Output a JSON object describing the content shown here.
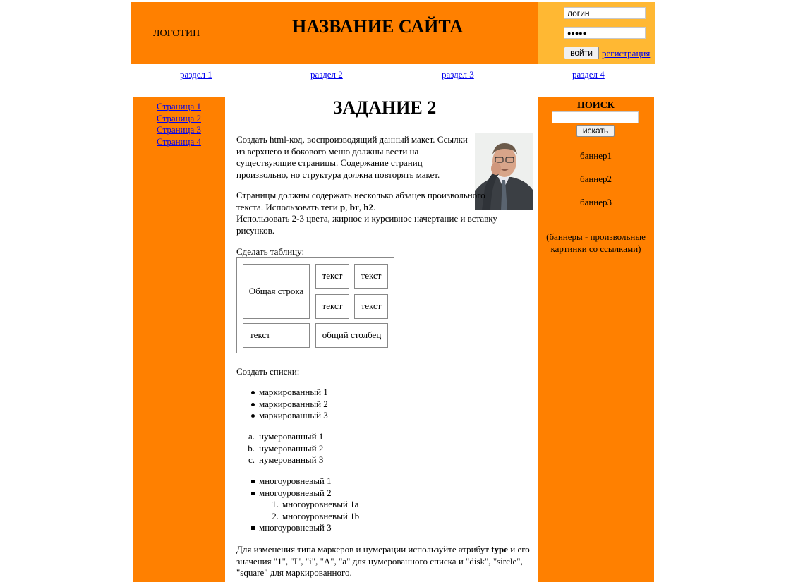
{
  "header": {
    "logo": "ЛОГОТИП",
    "site_title": "НАЗВАНИЕ САЙТА",
    "login_value": "логин",
    "password_value": "●●●●●",
    "login_button": "войти",
    "register_link": "регистрация"
  },
  "topnav": [
    "раздел 1",
    "раздел 2",
    "раздел 3",
    "раздел 4"
  ],
  "sidebar": {
    "pages": [
      "Страница 1",
      "Страница 2",
      "Страница 3",
      "Страница 4"
    ]
  },
  "search": {
    "title": "ПОИСК",
    "button": "искать"
  },
  "banners": [
    "баннер1",
    "баннер2",
    "баннер3"
  ],
  "banner_note": "(баннеры - произвольные картинки со ссылками)",
  "main": {
    "title": "ЗАДАНИЕ 2",
    "p1": "Создать html-код, воспроизводящий данный макет. Ссылки из верхнего и бокового меню должны вести на существующие страницы. Содержание страниц произвольно, но структура должна повторять макет.",
    "p2_a": "Страницы должны содержать несколько абзацев произвольного текста. Использовать теги ",
    "p2_tag1": "p",
    "p2_sep1": ", ",
    "p2_tag2": "br",
    "p2_sep2": ", ",
    "p2_tag3": "h2",
    "p2_b": ".",
    "p2_c": "Использовать 2-3 цвета, жирное и курсивное начертание и вставку рисунков.",
    "p3": "Сделать таблицу:",
    "table": {
      "merged_row": "Общая строка",
      "cell_text": "текст",
      "merged_col": "общий столбец"
    },
    "p4": "Создать списки:",
    "bullet_list": [
      "маркированный 1",
      "маркированный 2",
      "маркированный 3"
    ],
    "alpha_markers": [
      "a.",
      "b.",
      "c."
    ],
    "alpha_list": [
      "нумерованный 1",
      "нумерованный 2",
      "нумерованный 3"
    ],
    "multi_list": [
      "многоуровневый 1",
      "многоуровневый 2",
      "многоуровневый 3"
    ],
    "sub_markers": [
      "1.",
      "2."
    ],
    "sub_list": [
      "многоуровневый 1a",
      "многоуровневый 1b"
    ],
    "p5_a": "Для изменения типа маркеров и нумерации используйте атрибут ",
    "p5_attr": "type",
    "p5_b": " и его значения \"1\", \"I\", \"i\", \"A\", \"a\" для нумерованного списка и \"disk\", \"sircle\", \"square\" для маркированного."
  },
  "colors": {
    "orange": "#ff8000",
    "light_orange": "#ffb833",
    "link": "#0000ee"
  }
}
